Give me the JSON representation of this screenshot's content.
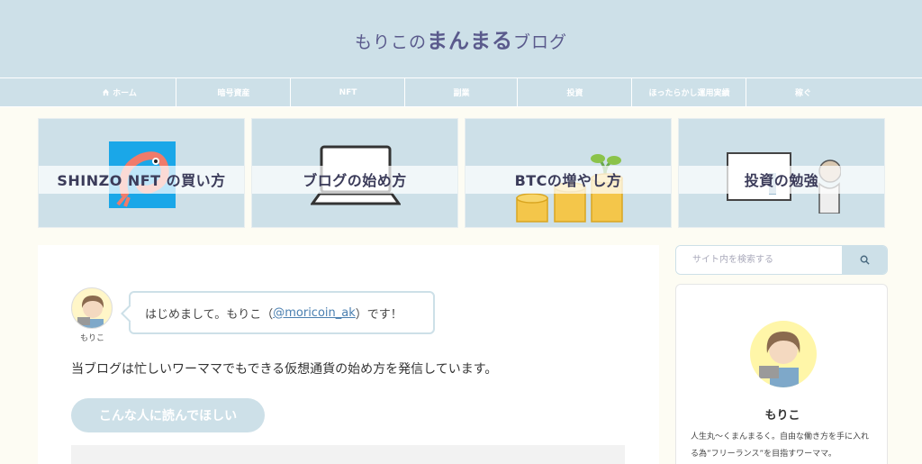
{
  "header": {
    "title_part1": "もりこの",
    "title_part2": "まんまる",
    "title_part3": "ブログ"
  },
  "nav": {
    "items": [
      {
        "label": "ホーム",
        "icon": "home-icon"
      },
      {
        "label": "暗号資産"
      },
      {
        "label": "NFT"
      },
      {
        "label": "副業"
      },
      {
        "label": "投資"
      },
      {
        "label": "ほったらかし運用実績"
      },
      {
        "label": "稼ぐ"
      }
    ]
  },
  "featured": [
    {
      "label": "SHINZO NFT の買い方"
    },
    {
      "label": "ブログの始め方"
    },
    {
      "label": "BTCの増やし方"
    },
    {
      "label": "投資の勉強"
    }
  ],
  "main": {
    "avatar_caption": "もりこ",
    "speech_prefix": "はじめまして。もりこ（",
    "speech_link": "@moricoin_ak",
    "speech_suffix": "）です！",
    "intro": "当ブログは忙しいワーママでもできる仮想通貨の始め方を発信しています。",
    "heading_pill": "こんな人に読んでほしい"
  },
  "sidebar": {
    "search_placeholder": "サイト内を検索する",
    "profile_name": "もりこ",
    "profile_bio": "人生丸〜くまんまるく。自由な働き方を手に入れる為”フリーランス”を目指すワーママ。"
  },
  "colors": {
    "header_bg": "#cde0e8",
    "page_bg": "#fdfcf3",
    "title_text": "#5a5a8c",
    "link": "#4a7fb0"
  }
}
